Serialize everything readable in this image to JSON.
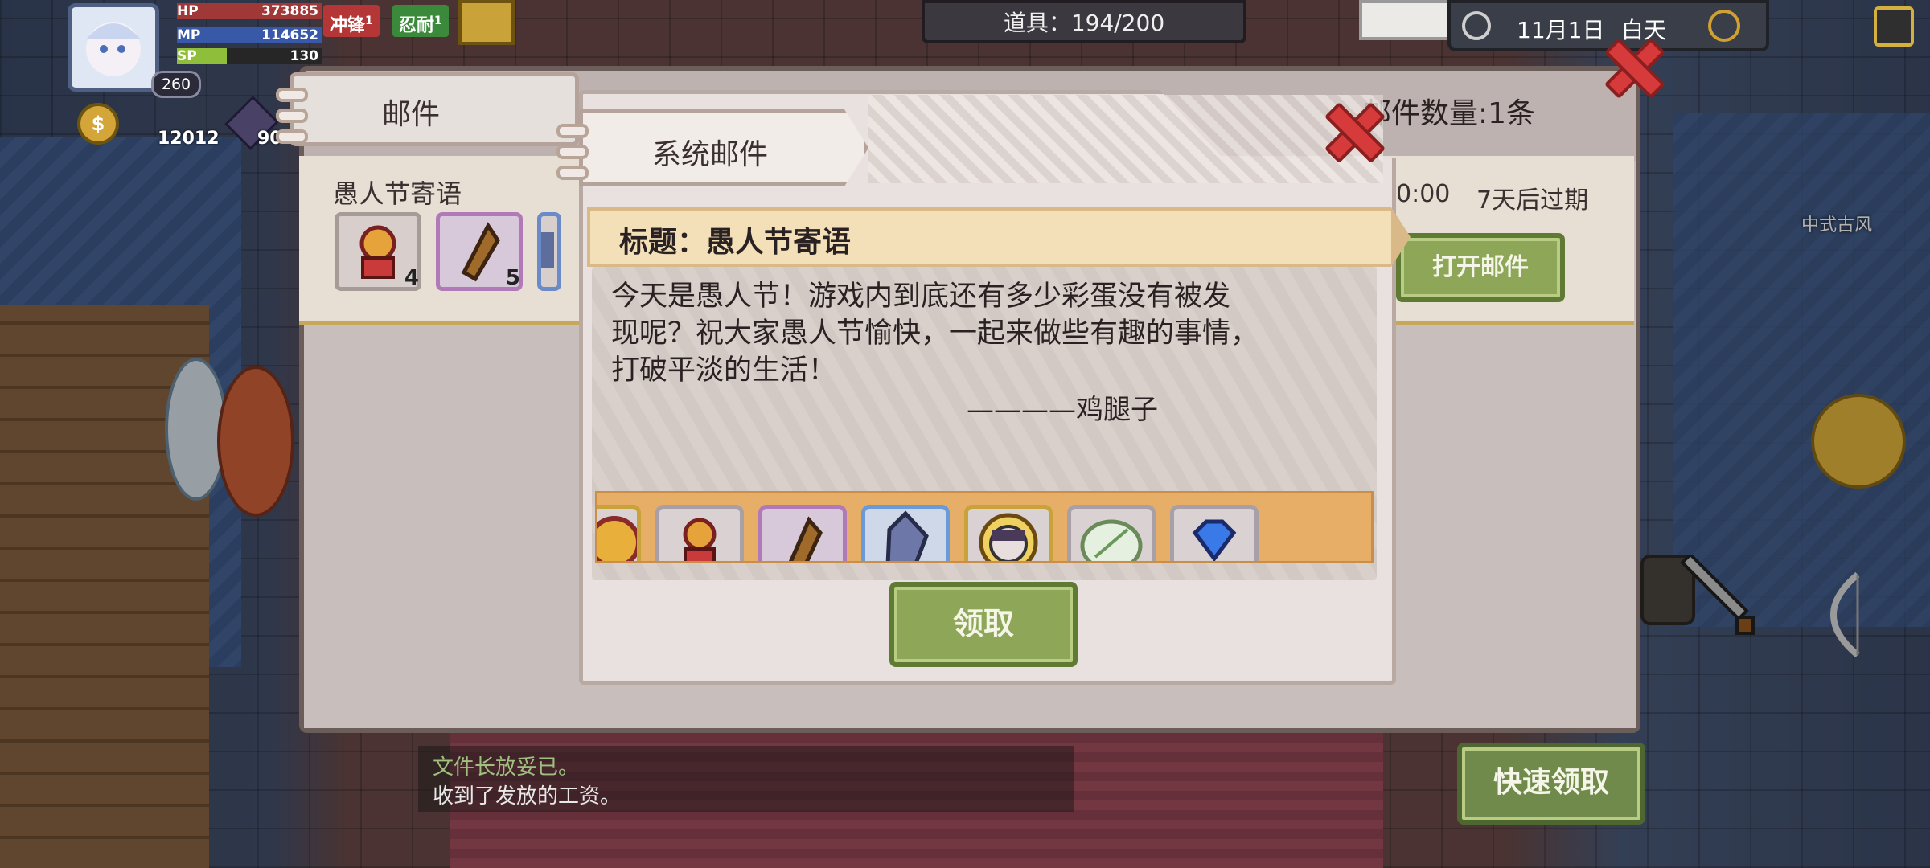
{
  "hud": {
    "hp_label": "HP",
    "hp_value": "373885",
    "mp_label": "MP",
    "mp_value": "114652",
    "sp_label": "SP",
    "sp_value": "130",
    "level": "260",
    "buff_charge": "冲锋",
    "buff_charge_count": "1",
    "buff_endure": "忍耐",
    "buff_endure_count": "1",
    "currency_1": "12012",
    "currency_2": "90",
    "items_label": "道具：194/200",
    "date": "11月1日",
    "time_of_day": "白天"
  },
  "scene": {
    "location_label": "中式古风"
  },
  "mail_panel": {
    "title": "邮件",
    "mail_count": "邮件数量:1条",
    "item_title": "愚人节寄语",
    "item_time": "0:00",
    "item_expiry": "7天后过期",
    "open_button": "打开邮件",
    "quick_claim_button": "快速领取",
    "slots": [
      {
        "icon": "gift-medal-icon",
        "count": "4"
      },
      {
        "icon": "wood-log-icon",
        "count": "5"
      },
      {
        "icon": "crystal-icon",
        "count": ""
      }
    ]
  },
  "chat_log": {
    "line1": "文件长放妥已。",
    "line2": "收到了发放的工资。"
  },
  "dialog": {
    "tab_title": "系统邮件",
    "subject": "标题：愚人节寄语",
    "body_line1": "今天是愚人节！游戏内到底还有多少彩蛋没有被发",
    "body_line2": "现呢？祝大家愚人节愉快，一起来做些有趣的事情，",
    "body_line3": "打破平淡的生活！",
    "signature": "————鸡腿子",
    "claim_button": "领取",
    "rewards": [
      {
        "icon": "coin-icon"
      },
      {
        "icon": "gift-medal-icon"
      },
      {
        "icon": "wood-log-icon"
      },
      {
        "icon": "crystal-icon"
      },
      {
        "icon": "character-portrait-icon"
      },
      {
        "icon": "jade-leaf-icon"
      },
      {
        "icon": "diamond-icon"
      }
    ]
  },
  "colors": {
    "panel_border": "#6b5e5a",
    "button_green": "#8da658",
    "close_red": "#d63a3a",
    "reward_strip": "#e7ae68"
  }
}
